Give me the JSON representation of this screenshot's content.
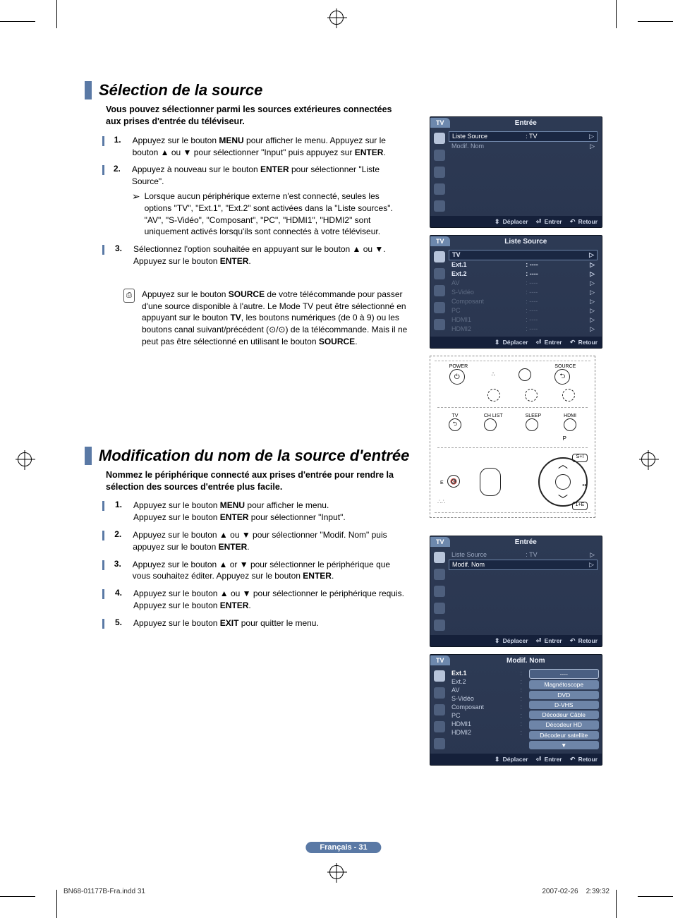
{
  "section1": {
    "title": "Sélection de la source",
    "intro": "Vous pouvez sélectionner parmi les sources extérieures connectées aux prises d'entrée du téléviseur.",
    "steps": [
      {
        "n": "1.",
        "body": "Appuyez sur le bouton <b>MENU</b> pour afficher le menu. Appuyez sur le bouton ▲ ou ▼ pour sélectionner \"Input\" puis appuyez sur <b>ENTER</b>."
      },
      {
        "n": "2.",
        "body": "Appuyez à nouveau sur le bouton <b>ENTER</b> pour sélectionner \"Liste Source\".",
        "sub": "Lorsque aucun périphérique externe n'est connecté, seules les options \"TV\", \"Ext.1\", \"Ext.2\" sont activées dans la \"Liste sources\". \"AV\", \"S-Vidéo\", \"Composant\", \"PC\", \"HDMI1\", \"HDMI2\" sont uniquement activés lorsqu'ils sont connectés à votre téléviseur."
      },
      {
        "n": "3.",
        "body": "Sélectionnez l'option souhaitée en appuyant sur le bouton ▲ ou ▼.<br>Appuyez sur le bouton <b>ENTER</b>."
      }
    ],
    "tip": "Appuyez sur le bouton <b>SOURCE</b> de votre télécommande pour passer d'une source disponible à l'autre. Le Mode TV peut être sélectionné en appuyant sur le bouton <b>TV</b>, les boutons numériques (de 0 à 9) ou les boutons canal suivant/précédent (⊙/⊙) de la télécommande. Mais il ne peut pas être sélectionné en utilisant le bouton <b>SOURCE</b>."
  },
  "section2": {
    "title": "Modification du nom de la source d'entrée",
    "intro": "Nommez le périphérique connecté aux prises d'entrée pour rendre la sélection des sources d'entrée plus facile.",
    "steps": [
      {
        "n": "1.",
        "body": "Appuyez sur le bouton <b>MENU</b> pour afficher le menu.<br>Appuyez sur le bouton <b>ENTER</b> pour sélectionner \"Input\"."
      },
      {
        "n": "2.",
        "body": "Appuyez sur le bouton ▲ ou ▼ pour sélectionner \"Modif. Nom\" puis appuyez sur le bouton <b>ENTER</b>."
      },
      {
        "n": "3.",
        "body": "Appuyez sur le bouton ▲ or ▼ pour sélectionner le périphérique que vous souhaitez éditer. Appuyez sur le bouton <b>ENTER</b>."
      },
      {
        "n": "4.",
        "body": "Appuyez sur le bouton ▲ ou ▼ pour sélectionner le périphérique requis.<br>Appuyez sur le bouton <b>ENTER</b>."
      },
      {
        "n": "5.",
        "body": "Appuyez sur le bouton <b>EXIT</b> pour quitter le menu."
      }
    ]
  },
  "osd": {
    "tab": "TV",
    "footer": {
      "move": "Déplacer",
      "enter": "Entrer",
      "return": "Retour"
    },
    "panel_entree": {
      "title": "Entrée",
      "rows": [
        {
          "lbl": "Liste Source",
          "val": ": TV",
          "hl": true
        },
        {
          "lbl": "Modif. Nom",
          "val": ""
        }
      ]
    },
    "panel_liste": {
      "title": "Liste Source",
      "rows": [
        {
          "lbl": "TV",
          "val": "",
          "hl": true,
          "act": true
        },
        {
          "lbl": "Ext.1",
          "val": ": ----",
          "act": true
        },
        {
          "lbl": "Ext.2",
          "val": ": ----",
          "act": true
        },
        {
          "lbl": "AV",
          "val": ": ----",
          "dim": true
        },
        {
          "lbl": "S-Vidéo",
          "val": ": ----",
          "dim": true
        },
        {
          "lbl": "Composant",
          "val": ": ----",
          "dim": true
        },
        {
          "lbl": "PC",
          "val": ": ----",
          "dim": true
        },
        {
          "lbl": "HDMI1",
          "val": ": ----",
          "dim": true
        },
        {
          "lbl": "HDMI2",
          "val": ": ----",
          "dim": true
        }
      ]
    },
    "panel_entree2": {
      "title": "Entrée",
      "rows": [
        {
          "lbl": "Liste Source",
          "val": ": TV"
        },
        {
          "lbl": "Modif. Nom",
          "val": "",
          "hl": true
        }
      ]
    },
    "panel_modif": {
      "title": "Modif. Nom",
      "left": [
        "Ext.1",
        "Ext.2",
        "AV",
        "S-Vidéo",
        "Composant",
        "PC",
        "HDMI1",
        "HDMI2"
      ],
      "right": [
        "----",
        "Magnétoscope",
        "DVD",
        "D-VHS",
        "Décodeur Câble",
        "Décodeur HD",
        "Décodeur satellite",
        "▼"
      ]
    }
  },
  "remote": {
    "row1": {
      "power": "POWER",
      "source": "SOURCE"
    },
    "row2": [
      "TV",
      "CH LIST",
      "SLEEP",
      "HDMI"
    ],
    "p": "P",
    "e": "E",
    "s1": "S+I",
    "oneE": "1+E"
  },
  "page_badge": "Français - 31",
  "footer": {
    "file": "BN68-01177B-Fra.indd   31",
    "stamp": "2007-02-26      2:39:32"
  }
}
